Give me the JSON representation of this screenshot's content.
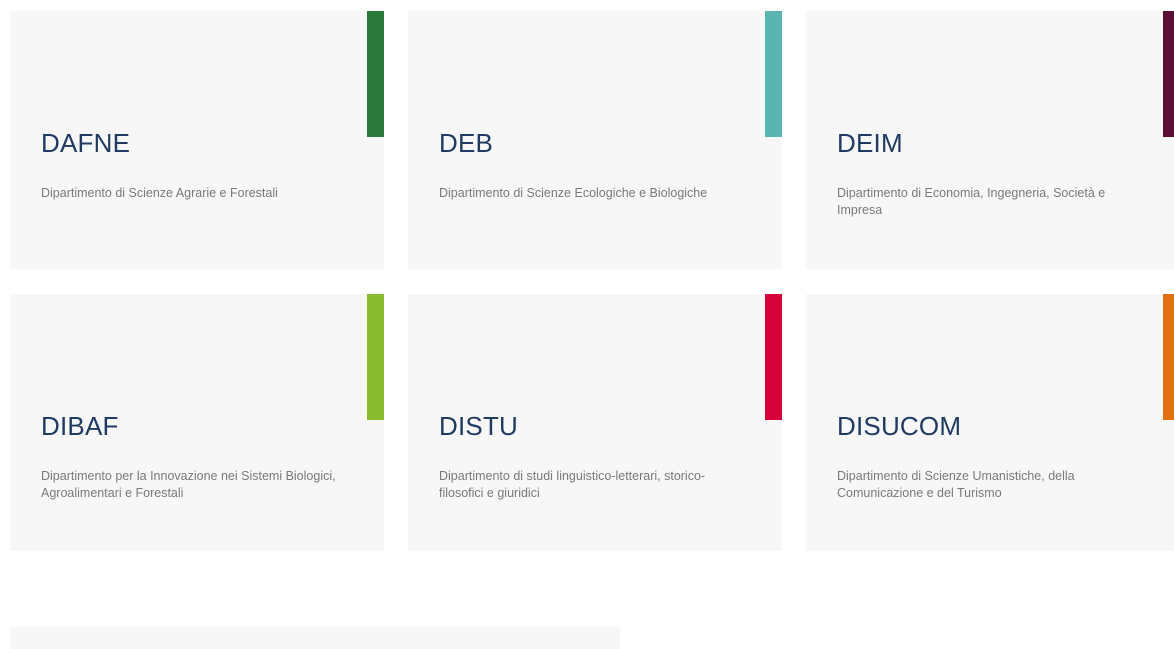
{
  "departments": [
    {
      "code": "DAFNE",
      "name": "Dipartimento di Scienze Agrarie e Forestali",
      "accent": "#2b7a3b"
    },
    {
      "code": "DEB",
      "name": "Dipartimento di Scienze Ecologiche e Biologiche",
      "accent": "#58b5b0"
    },
    {
      "code": "DEIM",
      "name": "Dipartimento di Economia, Ingegneria, Società e Impresa",
      "accent": "#5b0f33"
    },
    {
      "code": "DIBAF",
      "name": "Dipartimento per la Innovazione nei Sistemi Biologici, Agroalimentari e Forestali",
      "accent": "#8aba2e"
    },
    {
      "code": "DISTU",
      "name": "Dipartimento di studi linguistico-letterari, storico-filosofici e giuridici",
      "accent": "#d6003b"
    },
    {
      "code": "DISUCOM",
      "name": "Dipartimento di Scienze Umanistiche, della Comunicazione e del Turismo",
      "accent": "#e1710f"
    }
  ]
}
